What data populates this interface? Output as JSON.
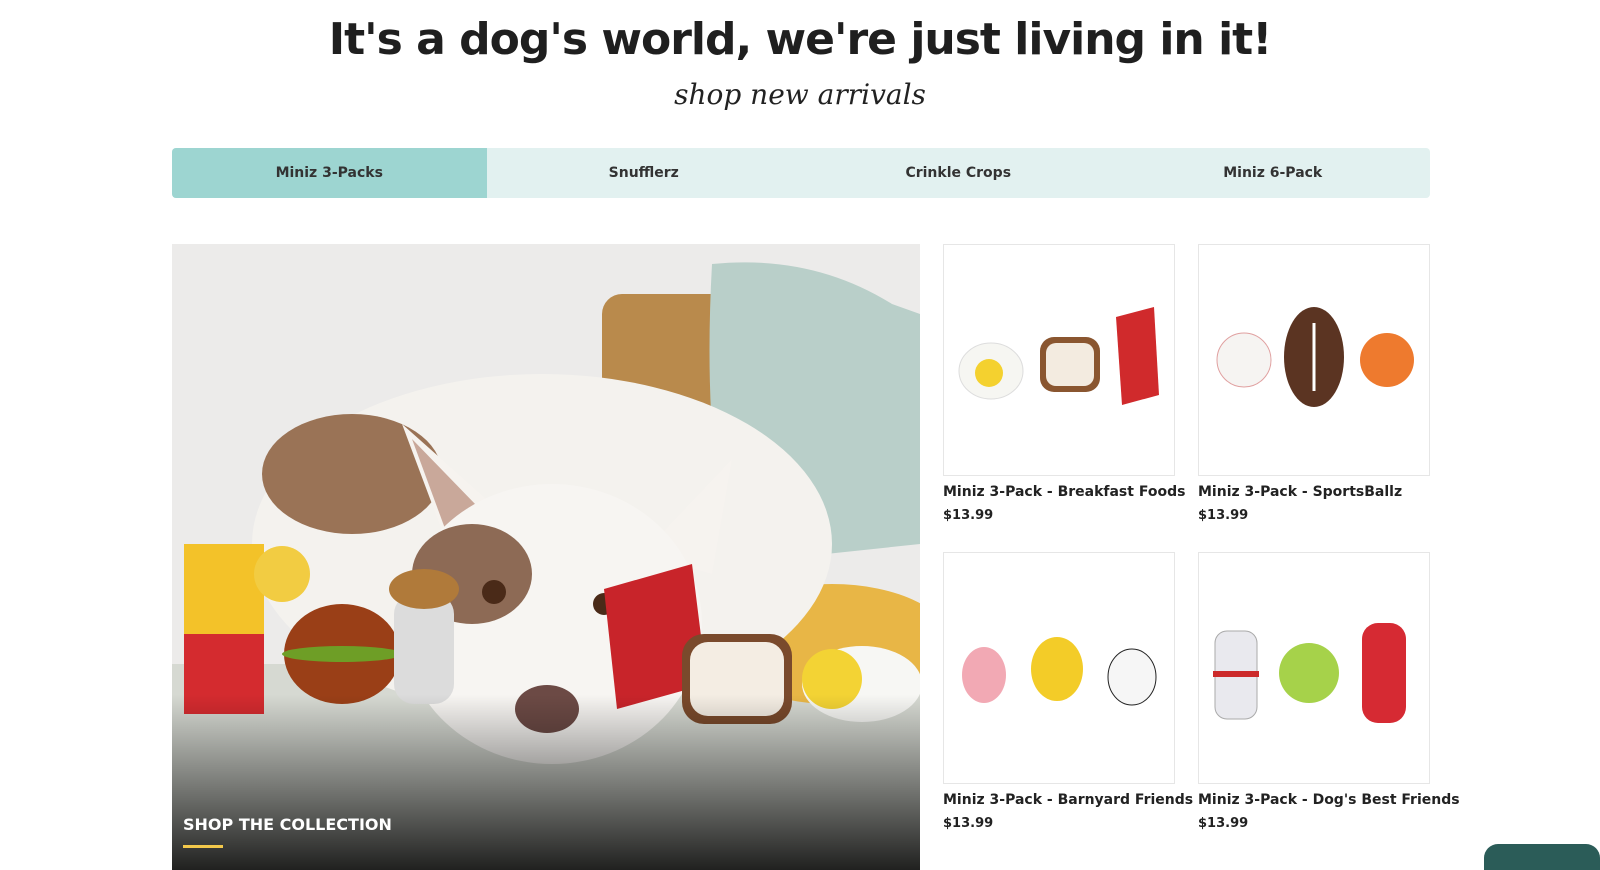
{
  "header": {
    "title": "It's a dog's world, we're just living in it!",
    "subtitle": "shop new arrivals"
  },
  "tabs": [
    {
      "label": "Miniz 3-Packs",
      "active": true
    },
    {
      "label": "Snufflerz",
      "active": false
    },
    {
      "label": "Crinkle Crops",
      "active": false
    },
    {
      "label": "Miniz 6-Pack",
      "active": false
    }
  ],
  "hero": {
    "cta_label": "SHOP THE COLLECTION"
  },
  "products": [
    {
      "title": "Miniz 3-Pack - Breakfast Foods",
      "price": "$13.99"
    },
    {
      "title": "Miniz 3-Pack - SportsBallz",
      "price": "$13.99"
    },
    {
      "title": "Miniz 3-Pack - Barnyard Friends",
      "price": "$13.99"
    },
    {
      "title": "Miniz 3-Pack - Dog's Best Friends",
      "price": "$13.99"
    }
  ],
  "colors": {
    "tab_bg": "#e2f1f0",
    "tab_active": "#9dd5d1",
    "accent_underline": "#f3c84b",
    "chat_button": "#2b5c58"
  }
}
